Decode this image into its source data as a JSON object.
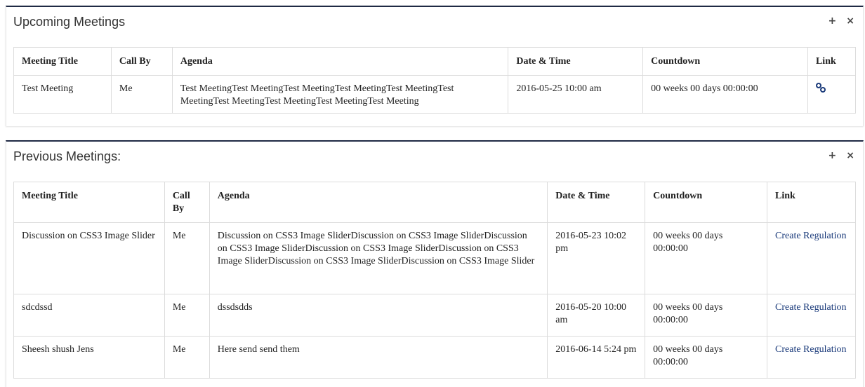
{
  "upcoming": {
    "title": "Upcoming Meetings",
    "tools": {
      "expand": "+",
      "close": "×"
    },
    "columns": [
      "Meeting Title",
      "Call By",
      "Agenda",
      "Date & Time",
      "Countdown",
      "Link"
    ],
    "rows": [
      {
        "title": "Test Meeting",
        "call_by": "Me",
        "agenda": "Test MeetingTest MeetingTest MeetingTest MeetingTest MeetingTest MeetingTest MeetingTest MeetingTest MeetingTest Meeting",
        "datetime": "2016-05-25 10:00 am",
        "countdown": "00 weeks 00 days 00:00:00",
        "link_icon": "chain-link-icon"
      }
    ]
  },
  "previous": {
    "title": "Previous Meetings:",
    "tools": {
      "expand": "+",
      "close": "×"
    },
    "columns": [
      "Meeting Title",
      "Call By",
      "Agenda",
      "Date & Time",
      "Countdown",
      "Link"
    ],
    "rows": [
      {
        "title": "Discussion on CSS3 Image Slider",
        "call_by": "Me",
        "agenda": "Discussion on CSS3 Image SliderDiscussion on CSS3 Image SliderDiscussion on CSS3 Image SliderDiscussion on CSS3 Image SliderDiscussion on CSS3 Image SliderDiscussion on CSS3 Image SliderDiscussion on CSS3 Image Slider",
        "datetime": "2016-05-23 10:02 pm",
        "countdown": "00 weeks 00 days 00:00:00",
        "link": "Create Regulation"
      },
      {
        "title": "sdcdssd",
        "call_by": "Me",
        "agenda": "dssdsdds",
        "datetime": "2016-05-20 10:00 am",
        "countdown": "00 weeks 00 days 00:00:00",
        "link": "Create Regulation"
      },
      {
        "title": "Sheesh shush Jens",
        "call_by": "Me",
        "agenda": "Here send send them",
        "datetime": "2016-06-14 5:24 pm",
        "countdown": "00 weeks 00 days 00:00:00",
        "link": "Create Regulation"
      }
    ]
  },
  "colors": {
    "panel_border": "#1f2a44",
    "link": "#1a3a7a"
  }
}
